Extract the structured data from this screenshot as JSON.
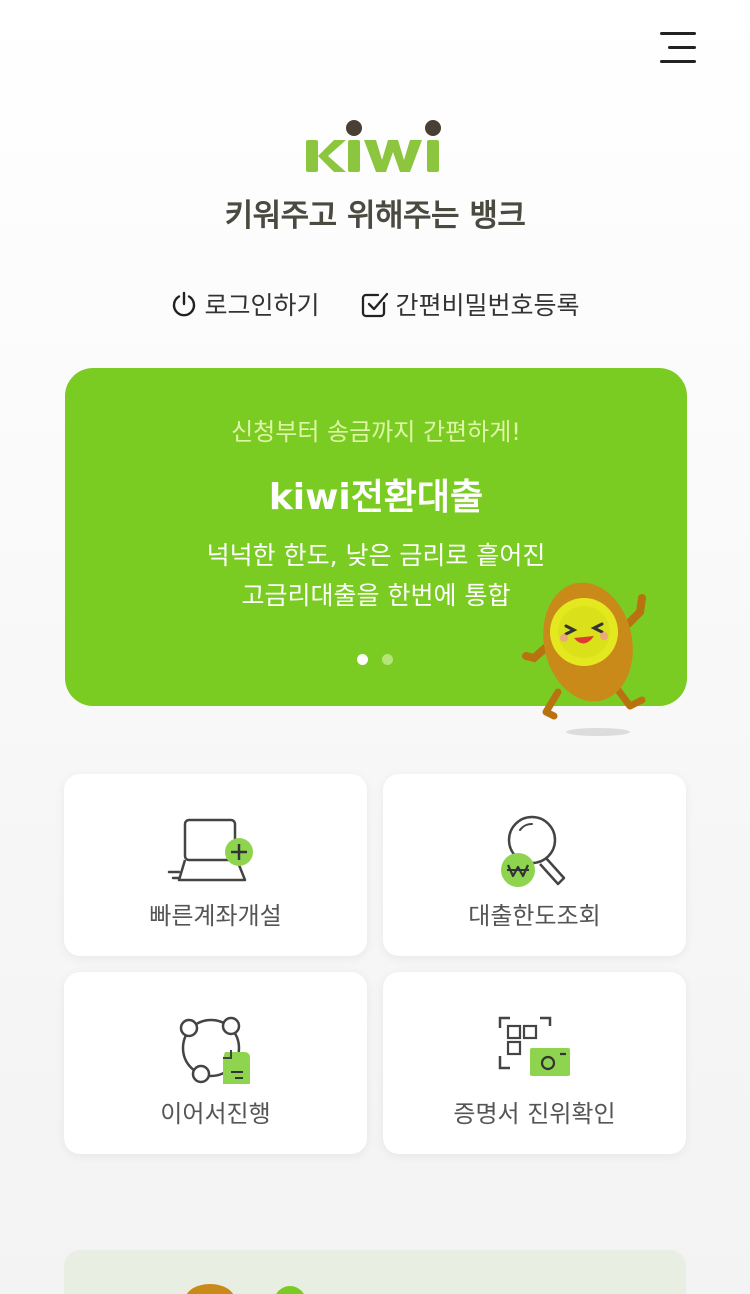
{
  "header": {
    "menu_icon": "hamburger-menu-icon",
    "logo_text": "kiwi",
    "slogan": "키워주고 위해주는 뱅크"
  },
  "auth": {
    "login_label": "로그인하기",
    "login_icon": "power-icon",
    "pin_label": "간편비밀번호등록",
    "pin_icon": "checkbox-icon"
  },
  "banner": {
    "eyebrow": "신청부터 송금까지 간편하게!",
    "title": "kiwi전환대출",
    "desc_line1": "넉넉한 한도, 낮은 금리로 흩어진",
    "desc_line2": "고금리대출을 한번에 통합",
    "current_slide": 1,
    "total_slides": 2,
    "bg_color": "#7bcc22"
  },
  "menu_cards": [
    {
      "label": "빠른계좌개설",
      "icon": "laptop-plus-icon"
    },
    {
      "label": "대출한도조회",
      "icon": "magnifier-won-icon"
    },
    {
      "label": "이어서진행",
      "icon": "resume-document-icon"
    },
    {
      "label": "증명서 진위확인",
      "icon": "qr-camera-icon"
    }
  ],
  "colors": {
    "accent": "#7bcc22",
    "logo_green": "#8cc63f",
    "logo_dot": "#4a3f35"
  }
}
